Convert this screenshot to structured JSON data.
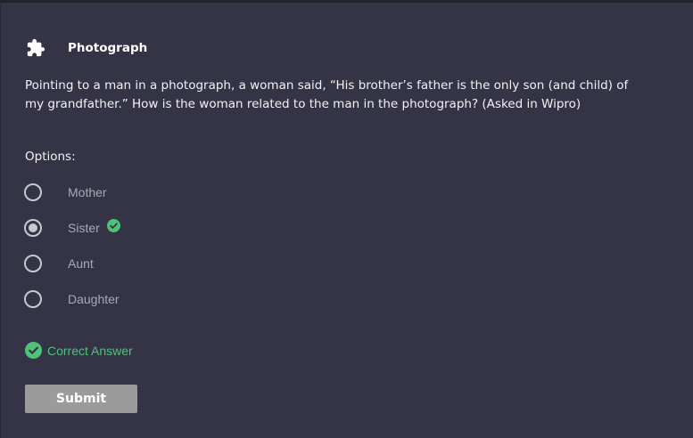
{
  "header": {
    "icon": "puzzle-piece-icon",
    "title": "Photograph"
  },
  "question": {
    "text": "Pointing to a man in a photograph, a woman said, “His brother’s father is the only son (and child) of my grandfather.” How is the woman related to the man in the photograph? (Asked in Wipro)"
  },
  "options": {
    "label": "Options:",
    "items": [
      {
        "label": "Mother",
        "selected": false,
        "correct": false
      },
      {
        "label": "Sister",
        "selected": true,
        "correct": true
      },
      {
        "label": "Aunt",
        "selected": false,
        "correct": false
      },
      {
        "label": "Daughter",
        "selected": false,
        "correct": false
      }
    ]
  },
  "result": {
    "icon": "check-circle-icon",
    "text": "Correct Answer",
    "color": "#4fc27a"
  },
  "submit": {
    "label": "Submit",
    "color": "#9b9b9b"
  },
  "colors": {
    "background": "#343446",
    "text": "#f2f2f5",
    "option_text": "#a9a9b6",
    "success": "#4fc27a"
  }
}
